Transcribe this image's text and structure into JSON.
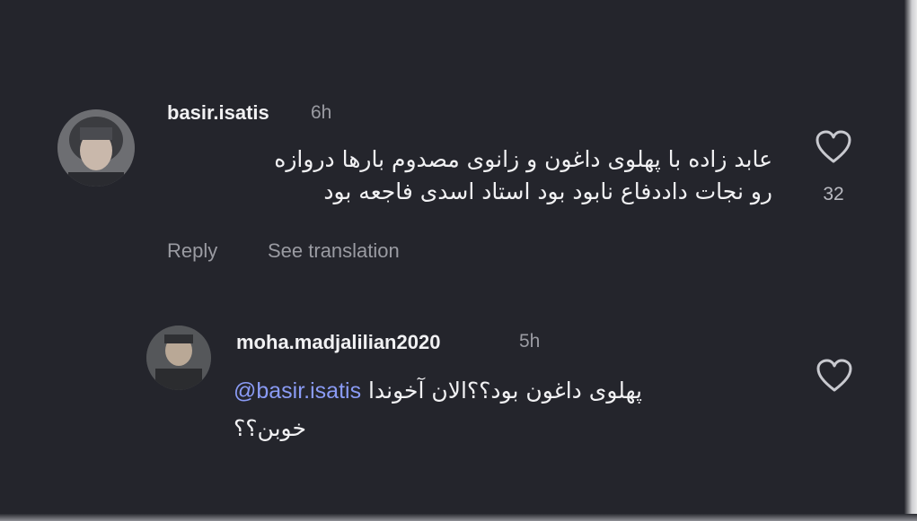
{
  "comments": [
    {
      "username": "basir.isatis",
      "time": "6h",
      "text_line1": "عابد زاده با پهلوی داغون و زانوی مصدوم بارها دروازه",
      "text_line2": "رو نجات داددفاع نابود بود استاد اسدی فاجعه بود",
      "likes": "32",
      "icon": "heart-outline-icon"
    }
  ],
  "actions": {
    "reply_label": "Reply",
    "translate_label": "See translation"
  },
  "replies": [
    {
      "username": "moha.madjalilian2020",
      "time": "5h",
      "mention": "@basir.isatis",
      "text_line1": "پهلوی داغون بود؟؟الان آخوندا",
      "text_line2": "خوبن؟؟",
      "icon": "heart-outline-icon"
    }
  ],
  "colors": {
    "background": "#24252c",
    "mention": "#8a9bf5",
    "muted": "#9a9ba2"
  }
}
